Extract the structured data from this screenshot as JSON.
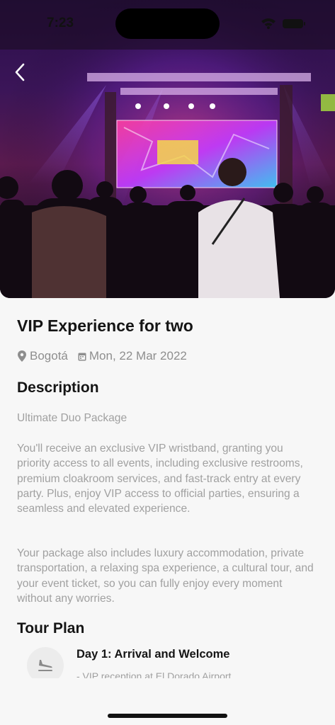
{
  "status_bar": {
    "time": "7:23"
  },
  "event": {
    "title": "VIP Experience for two",
    "location": "Bogotá",
    "date": "Mon, 22 Mar 2022"
  },
  "description": {
    "heading": "Description",
    "package_name": "Ultimate Duo Package",
    "paragraph_1": "You'll receive an exclusive VIP wristband, granting you priority access to all events, including exclusive restrooms, premium cloakroom services, and fast-track entry at every party. Plus, enjoy VIP access to official parties, ensuring a seamless and elevated experience.",
    "paragraph_2": "Your package also includes luxury accommodation, private transportation, a relaxing spa experience, a cultural tour, and your event ticket, so you can fully enjoy every moment without any worries."
  },
  "tour_plan": {
    "heading": "Tour Plan",
    "days": [
      {
        "title": "Day 1: Arrival and Welcome",
        "detail": "- VIP reception at El Dorado Airport.",
        "icon": "plane-landing-icon"
      }
    ]
  },
  "colors": {
    "heading": "#151515",
    "muted": "#a0a0a0",
    "background": "#f7f7f7"
  }
}
